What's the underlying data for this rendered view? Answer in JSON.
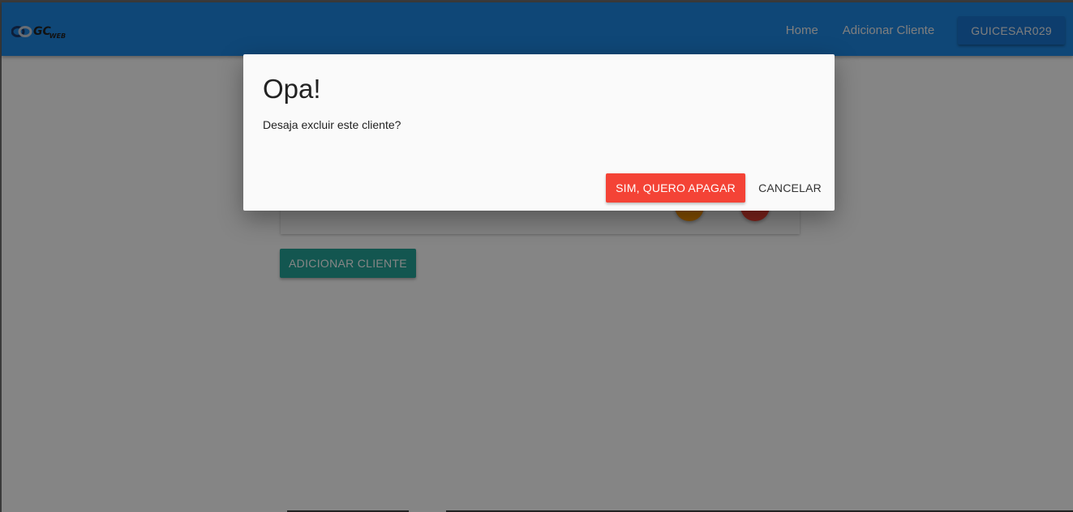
{
  "navbar": {
    "logo_text": "GC",
    "logo_sub": "WEB",
    "links": [
      "Home",
      "Adicionar Cliente"
    ],
    "user_button": "GUICESAR029",
    "color": "#1e88e5"
  },
  "page": {
    "add_button_label": "ADICIONAR CLIENTE",
    "add_button_color": "#26a69a",
    "edit_fab_color": "#ff9800",
    "delete_fab_color": "#f44336"
  },
  "modal": {
    "title": "Opa!",
    "message": "Desaja excluir este cliente?",
    "confirm_label": "SIM, QUERO APAGAR",
    "cancel_label": "CANCELAR",
    "confirm_color": "#f44336"
  }
}
